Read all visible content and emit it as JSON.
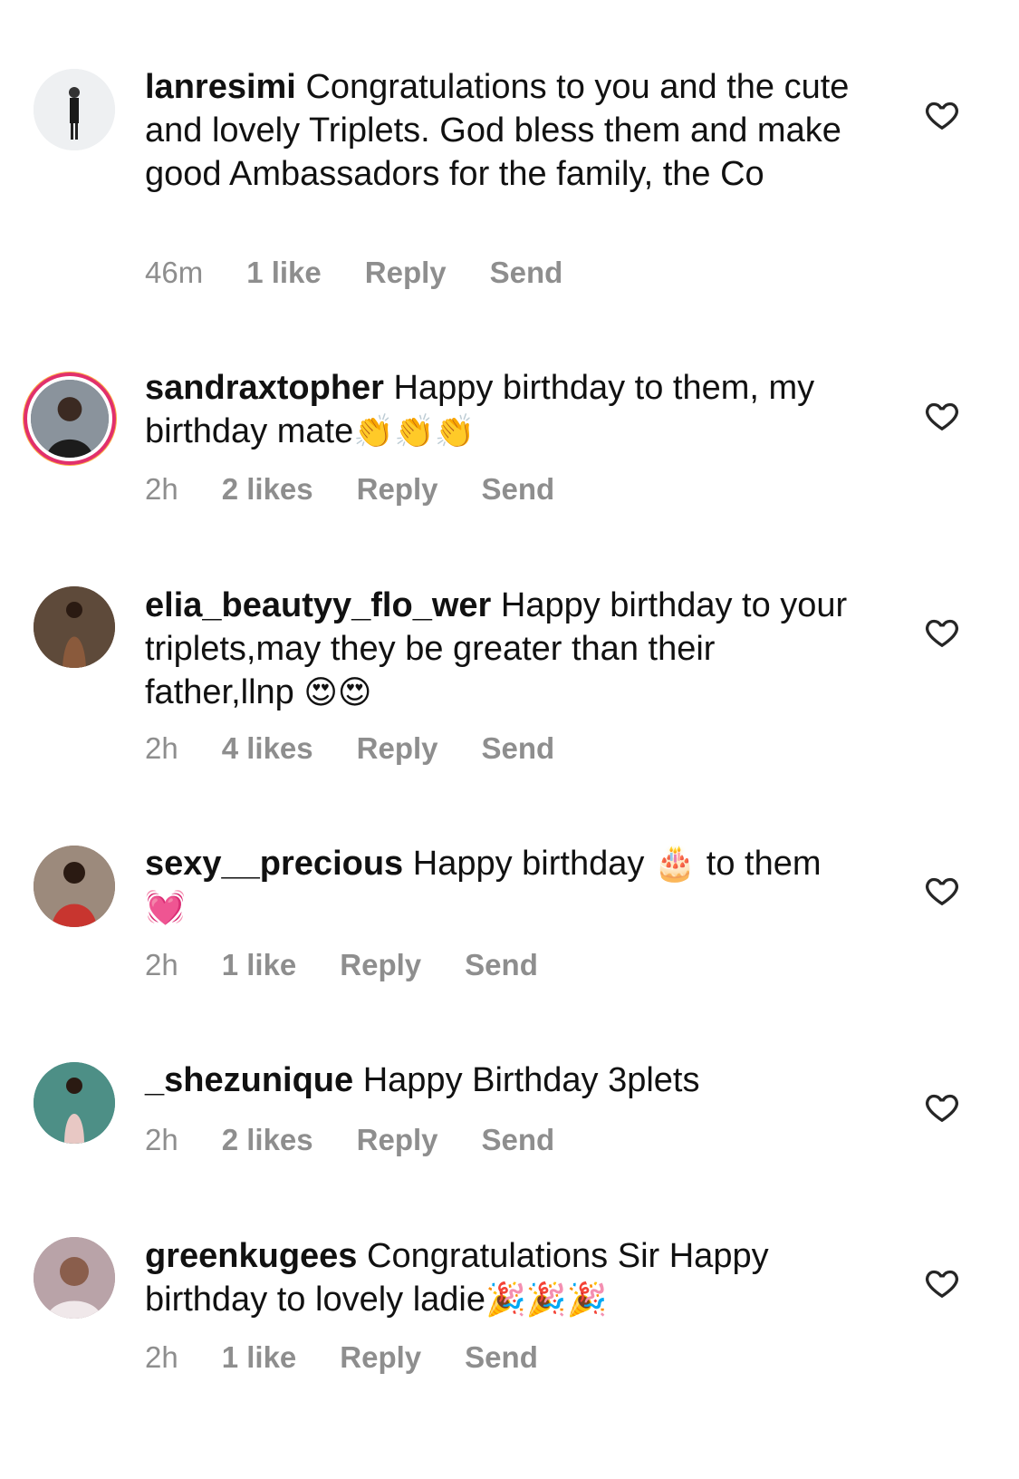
{
  "comments": [
    {
      "username": "lanresimi",
      "text": "Congratulations to you and the cute and lovely Triplets. God bless them and make good Ambassadors for the family, the Co",
      "emoji": "",
      "time": "46m",
      "likes": "1 like",
      "reply": "Reply",
      "send": "Send",
      "avatar_color": "#e9ecef",
      "ring": false
    },
    {
      "username": "sandraxtopher",
      "text": "Happy birthday to them, my birthday mate",
      "emoji": "👏👏👏",
      "time": "2h",
      "likes": "2 likes",
      "reply": "Reply",
      "send": "Send",
      "avatar_color": "#5b6470",
      "ring": true
    },
    {
      "username": "elia_beautyy_flo_wer",
      "text": "Happy birthday to your triplets,may they be greater than their father,llnp",
      "emoji": "😍😍",
      "time": "2h",
      "likes": "4 likes",
      "reply": "Reply",
      "send": "Send",
      "avatar_color": "#6b4a35",
      "ring": false
    },
    {
      "username": "sexy__precious",
      "text": "Happy birthday 🎂 to them",
      "emoji": "💓",
      "time": "2h",
      "likes": "1 like",
      "reply": "Reply",
      "send": "Send",
      "avatar_color": "#7a5a4a",
      "ring": false
    },
    {
      "username": "_shezunique",
      "text": "Happy Birthday 3plets",
      "emoji": "",
      "time": "2h",
      "likes": "2 likes",
      "reply": "Reply",
      "send": "Send",
      "avatar_color": "#4d8f86",
      "ring": false
    },
    {
      "username": "greenkugees",
      "text": "Congratulations Sir Happy birthday to lovely ladie",
      "emoji": "🎉🎉🎉",
      "time": "2h",
      "likes": "1 like",
      "reply": "Reply",
      "send": "Send",
      "avatar_color": "#a98b8f",
      "ring": false
    }
  ]
}
